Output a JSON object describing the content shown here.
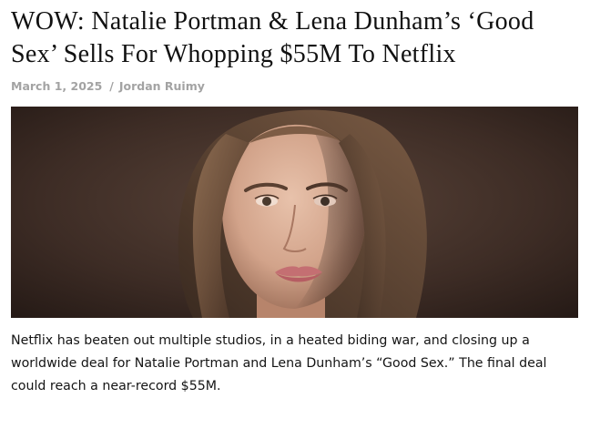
{
  "article": {
    "headline": "WOW: Natalie Portman & Lena Dunham’s ‘Good Sex’ Sells For Whopping $55M To Netflix",
    "date": "March 1, 2025",
    "separator": "/",
    "author": "Jordan Ruimy",
    "lede": "Netflix has beaten out multiple studios, in a heated biding war, and closing up a worldwide deal for Natalie Portman and Lena Dunham’s “Good Sex.” The final deal could reach a near-record $55M."
  }
}
